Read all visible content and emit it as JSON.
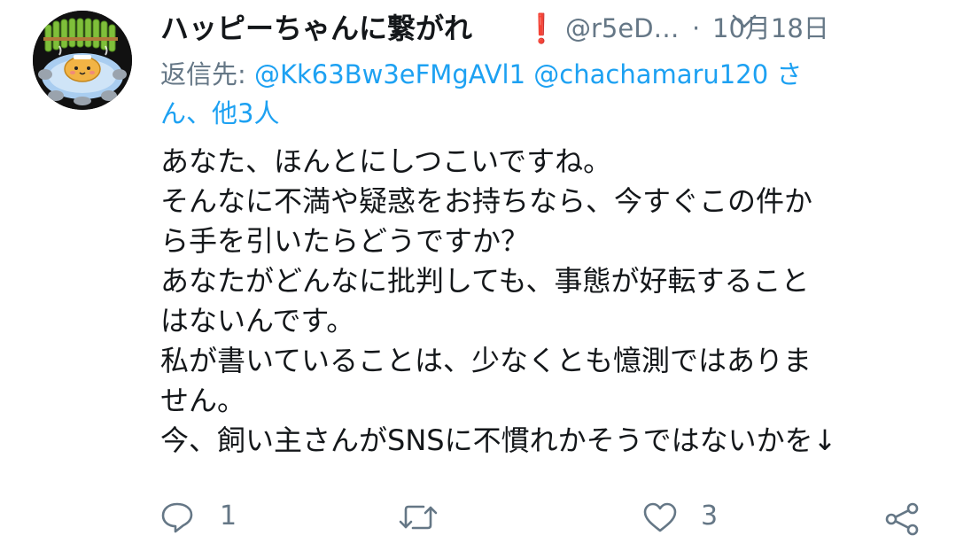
{
  "tweet": {
    "author": {
      "display_name": "ハッピーちゃんに繋がれ",
      "name_emoji": "❗",
      "handle": "@r5eD…",
      "avatar_icon": "onsen-character-avatar"
    },
    "separator": "·",
    "date": "10月18日",
    "more_icon": "chevron-down-icon",
    "reply_to": {
      "prefix": "返信先: ",
      "mention_1": "@Kk63Bw3eFMgAVl1",
      "mention_2": "@chachamaru120",
      "suffix_line1": " さ",
      "line2": "ん、他3人"
    },
    "text_lines": [
      "あなた、ほんとにしつこいですね。",
      "そんなに不満や疑惑をお持ちなら、今すぐこの件か",
      "ら手を引いたらどうですか？",
      "あなたがどんなに批判しても、事態が好転すること",
      "はないんです。",
      "私が書いていることは、少なくとも憶測ではありま",
      "せん。",
      "今、飼い主さんがSNSに不慣れかそうではないかを↓"
    ],
    "actions": {
      "reply": {
        "icon": "reply-bubble-icon",
        "count": "1"
      },
      "retweet": {
        "icon": "retweet-icon",
        "count": ""
      },
      "like": {
        "icon": "heart-icon",
        "count": "3"
      },
      "share": {
        "icon": "share-icon",
        "count": ""
      }
    }
  },
  "colors": {
    "text": "#14171a",
    "secondary": "#657786",
    "link": "#1da1f2",
    "emoji_red": "#e0201b"
  }
}
